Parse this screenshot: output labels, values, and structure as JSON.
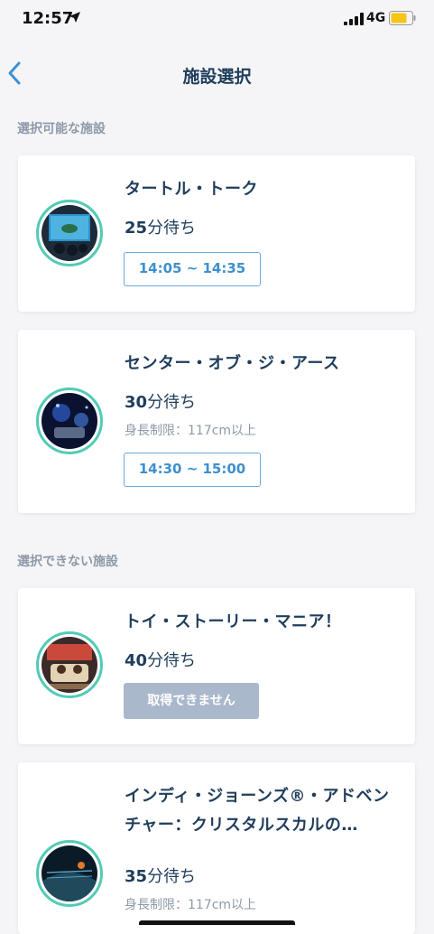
{
  "status": {
    "time": "12:57",
    "network": "4G"
  },
  "nav": {
    "title": "施設選択",
    "back_icon": "chevron-left-icon"
  },
  "sections": {
    "available": "選択可能な施設",
    "unavailable": "選択できない施設"
  },
  "cards": [
    {
      "name": "タートル・トーク",
      "wait_num": "25",
      "wait_unit": "分待ち",
      "restriction": "",
      "time": "14:05 ~ 14:35"
    },
    {
      "name": "センター・オブ・ジ・アース",
      "wait_num": "30",
      "wait_unit": "分待ち",
      "restriction": "身長制限：117cm以上",
      "time": "14:30 ~ 15:00"
    },
    {
      "name": "トイ・ストーリー・マニア！",
      "wait_num": "40",
      "wait_unit": "分待ち",
      "restriction": "",
      "button": "取得できません"
    },
    {
      "name": "インディ・ジョーンズ®・アドベンチャー：クリスタルスカルの…",
      "wait_num": "35",
      "wait_unit": "分待ち",
      "restriction": "身長制限：117cm以上"
    }
  ],
  "colors": {
    "accent": "#3f8fcf",
    "thumb_ring": "#52cbb5",
    "disabled": "#a9b8cb",
    "title": "#1f3d5c"
  }
}
